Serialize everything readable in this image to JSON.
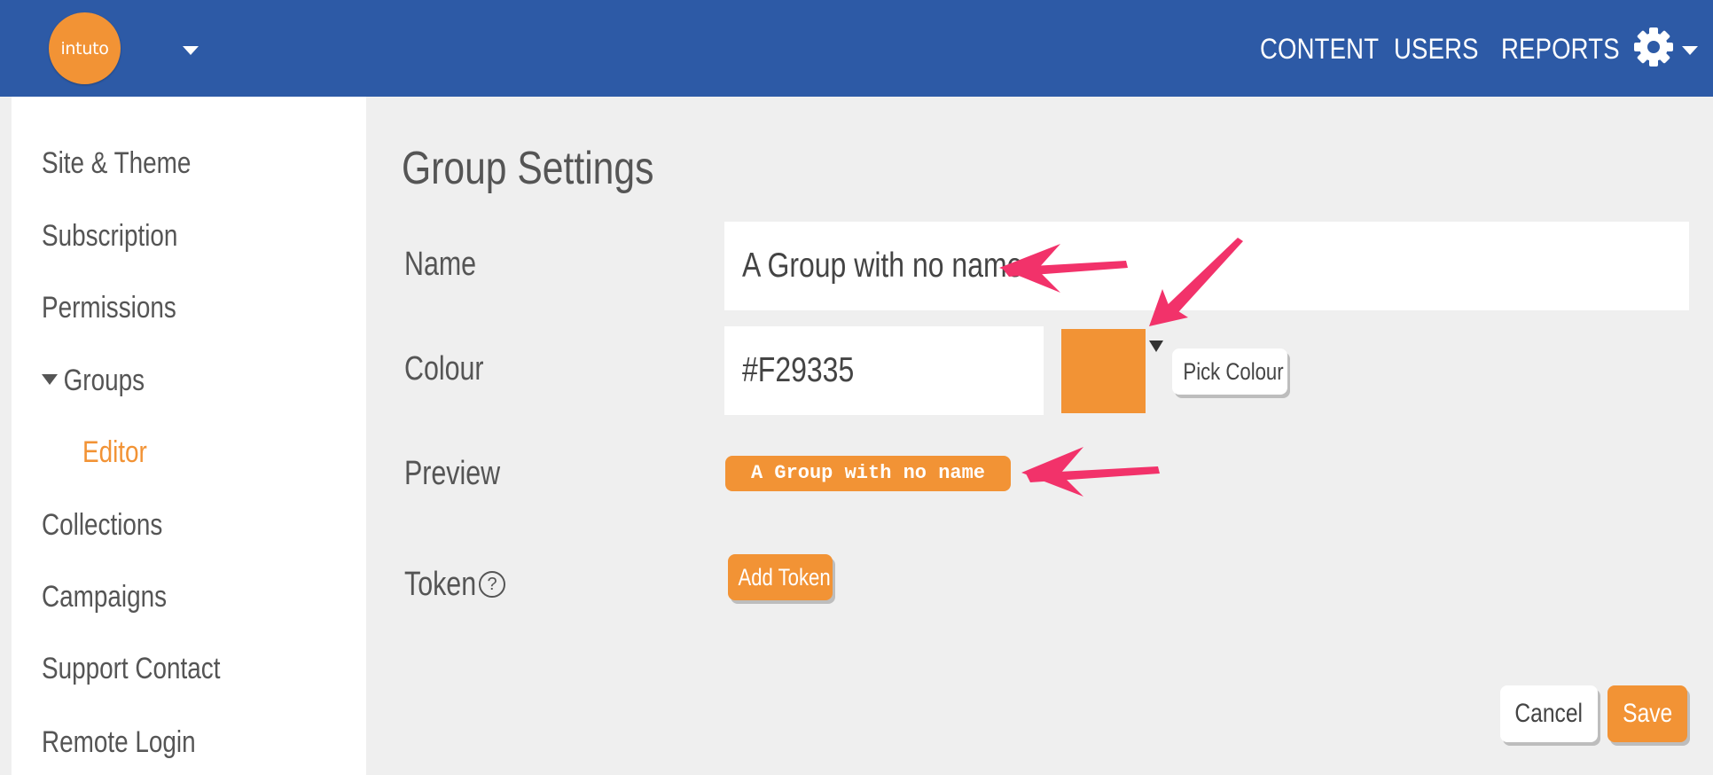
{
  "header": {
    "logo_text": "intuto",
    "nav": [
      "CONTENT",
      "USERS",
      "REPORTS"
    ],
    "icons": [
      "chevron-down-icon",
      "gear-icon"
    ]
  },
  "sidebar": {
    "items": [
      {
        "label": "Site & Theme"
      },
      {
        "label": "Subscription"
      },
      {
        "label": "Permissions"
      },
      {
        "label": "Groups",
        "expanded": true
      },
      {
        "label": "Editor",
        "active": true
      },
      {
        "label": "Collections"
      },
      {
        "label": "Campaigns"
      },
      {
        "label": "Support Contact"
      },
      {
        "label": "Remote Login"
      }
    ]
  },
  "form": {
    "title": "Group Settings",
    "name_label": "Name",
    "name_value": "A Group with no name",
    "colour_label": "Colour",
    "colour_value": "#F29335",
    "pick_colour_label": "Pick Colour",
    "preview_label": "Preview",
    "preview_text": "A Group with no name",
    "token_label": "Token",
    "help_glyph": "?",
    "add_token_label": "Add Token",
    "cancel_label": "Cancel",
    "save_label": "Save"
  },
  "colors": {
    "header_bg": "#2d5aa6",
    "accent": "#f29335",
    "annotation_arrow": "#f2326a"
  }
}
